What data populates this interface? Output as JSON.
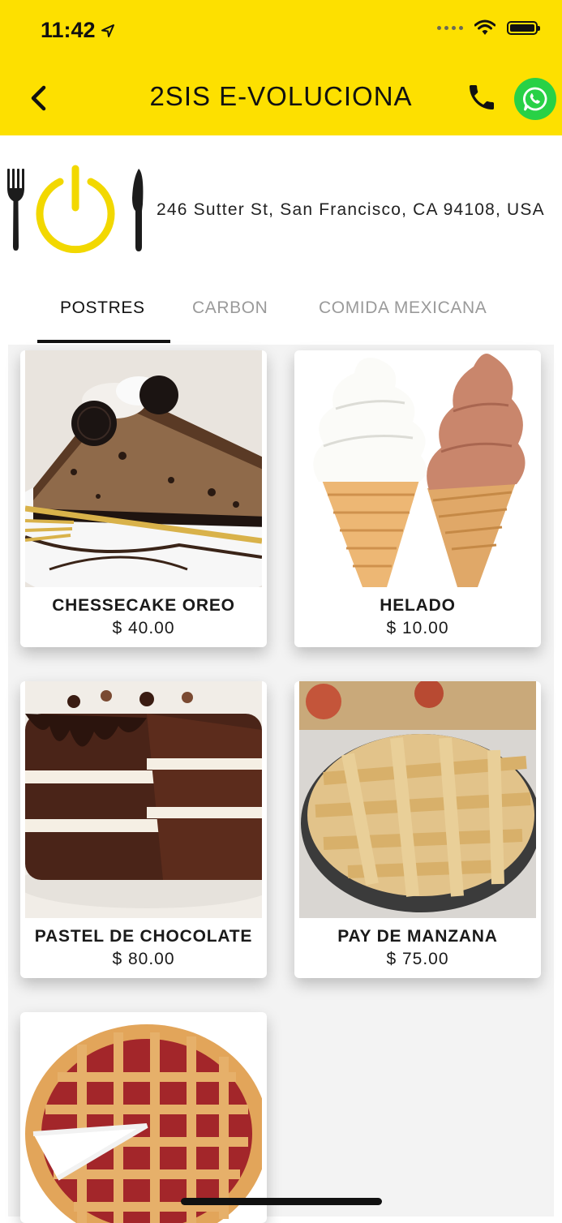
{
  "status_bar": {
    "time": "11:42"
  },
  "header": {
    "title": "2SIS E-VOLUCIONA",
    "bg_color": "#FDE000",
    "whatsapp_color": "#28D146"
  },
  "restaurant": {
    "address": "246 Sutter St, San Francisco, CA 94108, USA",
    "logo_color": "#F2D800"
  },
  "tabs": [
    {
      "label": "POSTRES",
      "active": true
    },
    {
      "label": "CARBON",
      "active": false
    },
    {
      "label": "COMIDA MEXICANA",
      "active": false
    }
  ],
  "products": [
    {
      "name": "CHESSECAKE OREO",
      "price": "$ 40.00",
      "image": "oreo-cheesecake-image"
    },
    {
      "name": "HELADO",
      "price": "$ 10.00",
      "image": "ice-cream-cones-image"
    },
    {
      "name": "PASTEL DE CHOCOLATE",
      "price": "$ 80.00",
      "image": "chocolate-cake-image"
    },
    {
      "name": "PAY DE MANZANA",
      "price": "$ 75.00",
      "image": "apple-pie-image"
    },
    {
      "name": "",
      "price": "",
      "image": "cherry-pie-image"
    }
  ]
}
